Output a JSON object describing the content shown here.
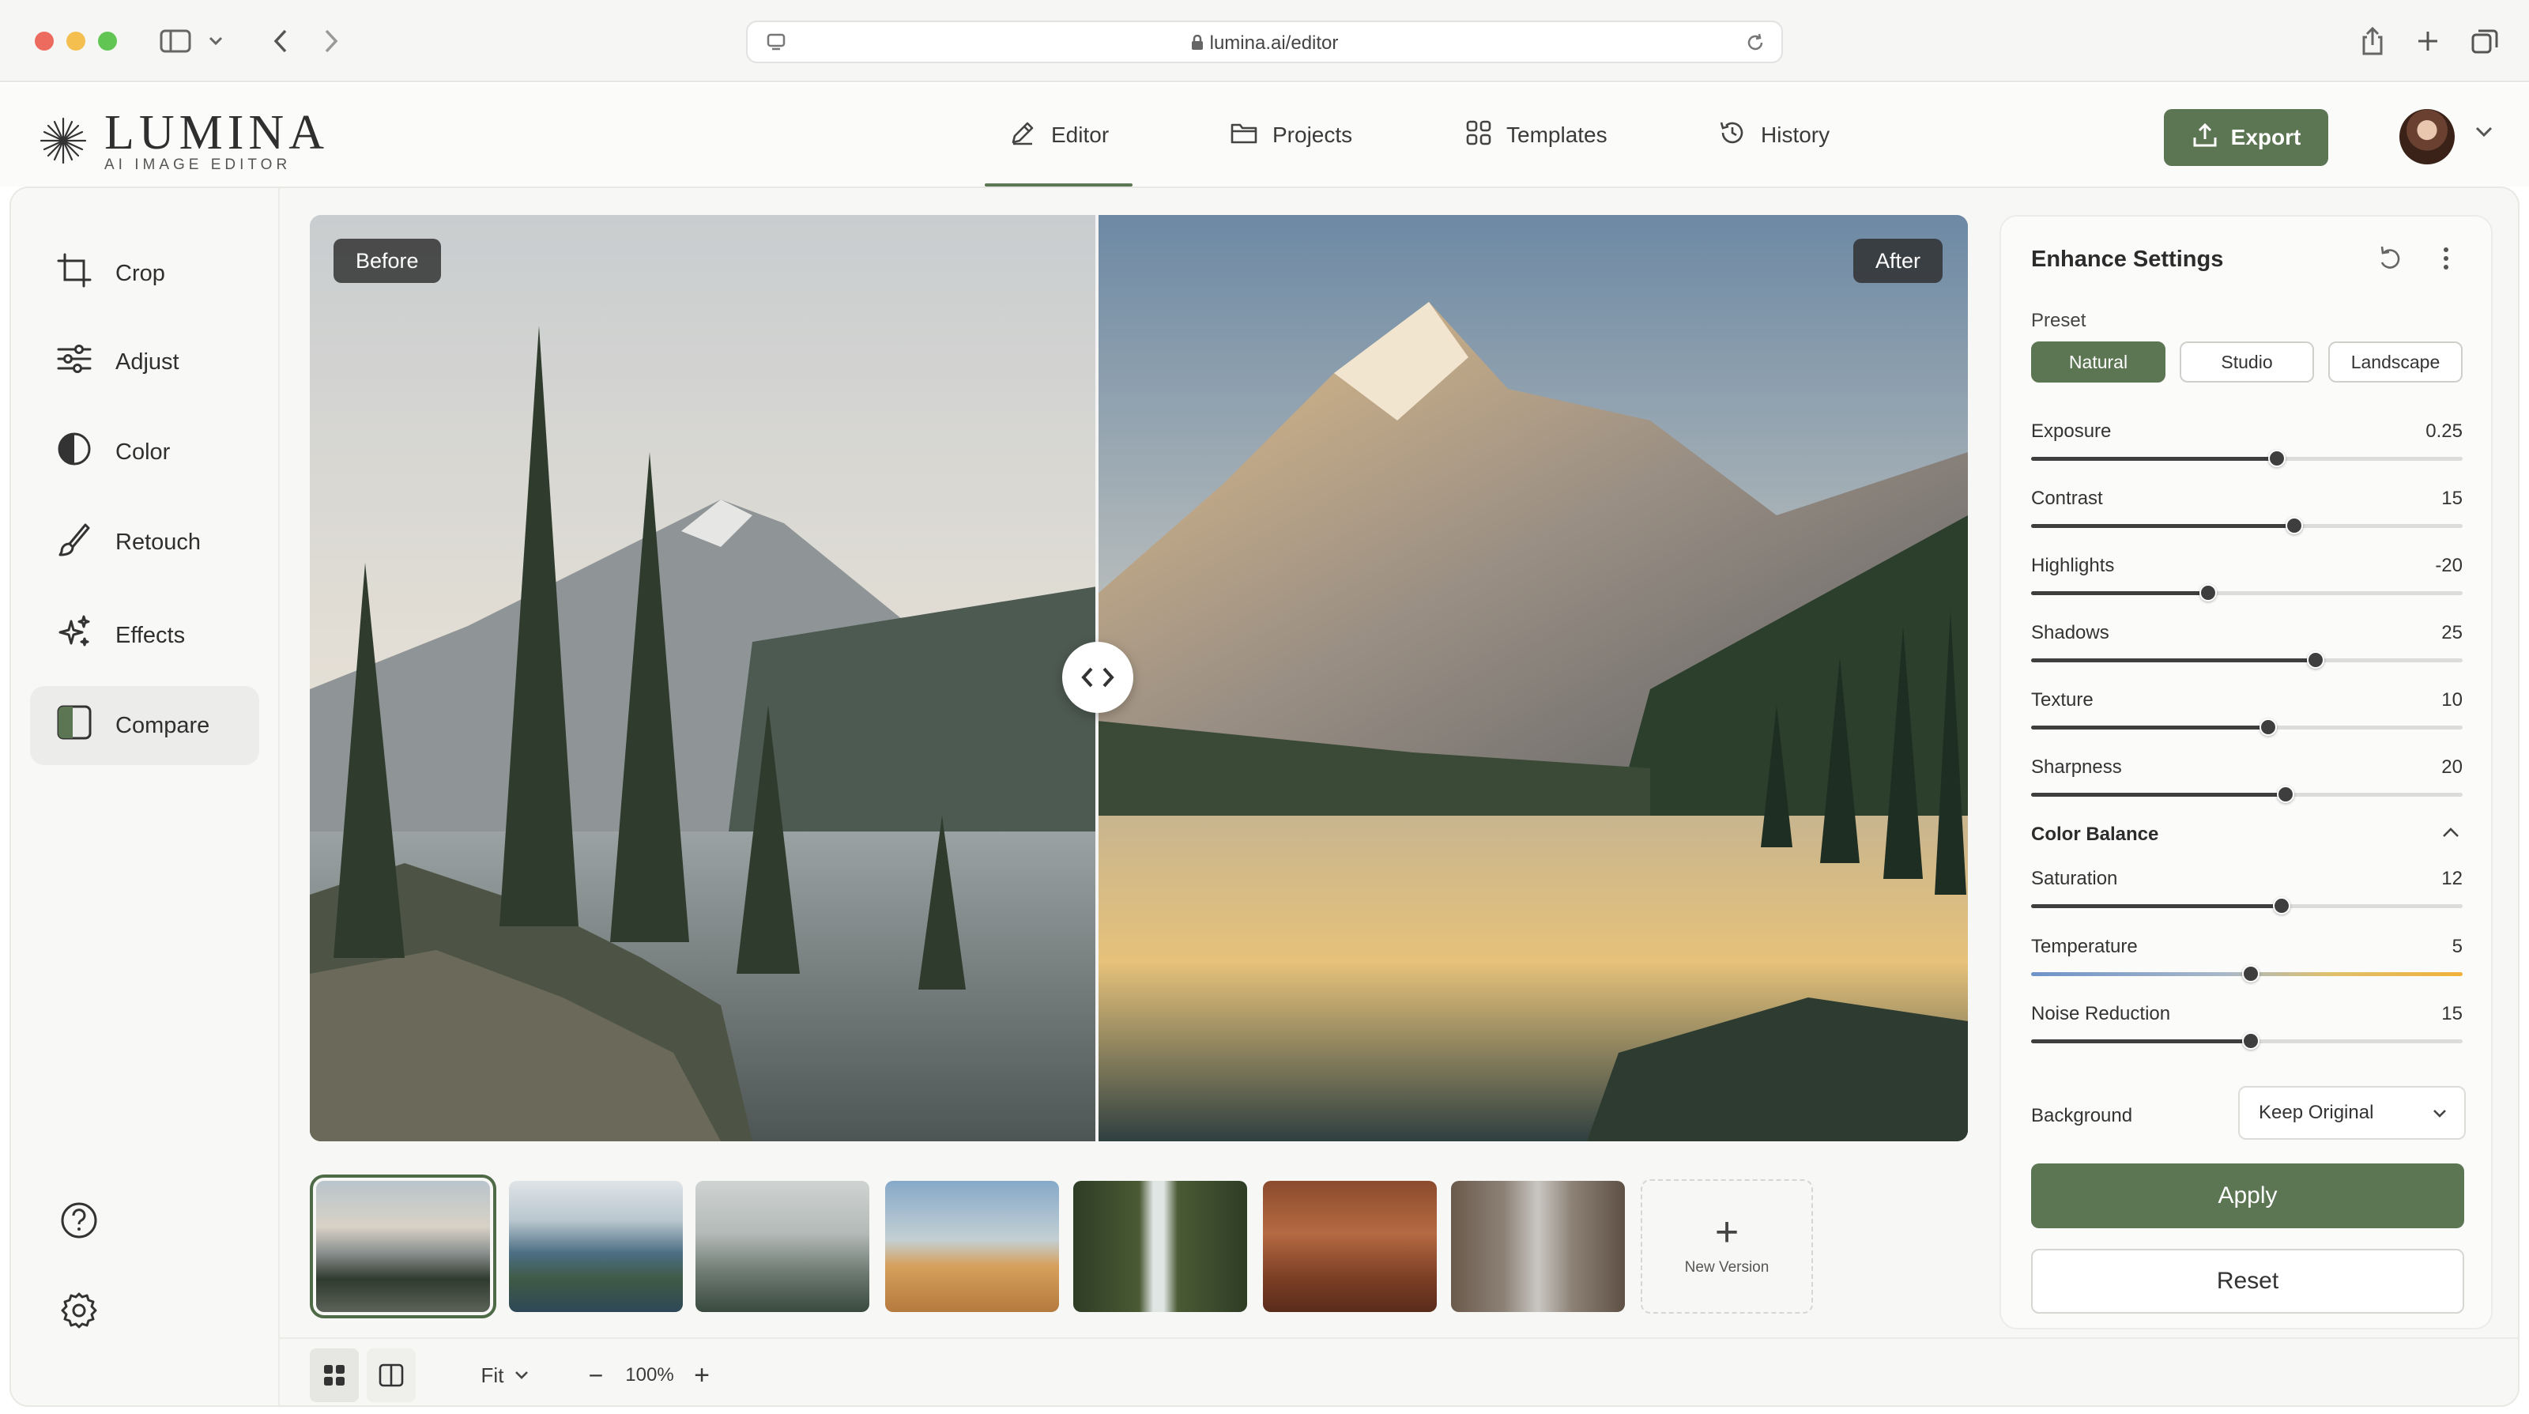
{
  "browser": {
    "url": "lumina.ai/editor"
  },
  "app": {
    "brand": "LUMINA",
    "tagline": "AI IMAGE EDITOR",
    "accent": "#5c7553"
  },
  "nav": {
    "tabs": [
      {
        "label": "Editor",
        "icon": "edit-icon",
        "active": true
      },
      {
        "label": "Projects",
        "icon": "folder-icon",
        "active": false
      },
      {
        "label": "Templates",
        "icon": "grid-icon",
        "active": false
      },
      {
        "label": "History",
        "icon": "history-icon",
        "active": false
      }
    ],
    "export_label": "Export"
  },
  "sidebar": {
    "tools": [
      {
        "label": "Crop",
        "icon": "crop-icon",
        "active": false
      },
      {
        "label": "Adjust",
        "icon": "sliders-icon",
        "active": false
      },
      {
        "label": "Color",
        "icon": "contrast-icon",
        "active": false
      },
      {
        "label": "Retouch",
        "icon": "brush-icon",
        "active": false
      },
      {
        "label": "Effects",
        "icon": "sparkles-icon",
        "active": false
      },
      {
        "label": "Compare",
        "icon": "compare-icon",
        "active": true
      }
    ],
    "bottom_icons": [
      "help-icon",
      "settings-icon"
    ]
  },
  "canvas": {
    "before_label": "Before",
    "after_label": "After"
  },
  "thumbnails": {
    "items": [
      "mountain-lake",
      "coastal-island",
      "misty-forest",
      "desert-tree",
      "waterfall",
      "canyon-city",
      "city-street"
    ],
    "selected_index": 0,
    "new_version_label": "New Version"
  },
  "toolbar": {
    "fit_label": "Fit",
    "zoom_label": "100%",
    "zoom_out": "−",
    "zoom_in": "+"
  },
  "panel": {
    "title": "Enhance Settings",
    "preset_label": "Preset",
    "presets": [
      {
        "label": "Natural",
        "active": true
      },
      {
        "label": "Studio",
        "active": false
      },
      {
        "label": "Landscape",
        "active": false
      }
    ],
    "sliders": [
      {
        "name": "Exposure",
        "value": "0.25",
        "fraction": 0.57
      },
      {
        "name": "Contrast",
        "value": "15",
        "fraction": 0.61
      },
      {
        "name": "Highlights",
        "value": "-20",
        "fraction": 0.41
      },
      {
        "name": "Shadows",
        "value": "25",
        "fraction": 0.66
      },
      {
        "name": "Texture",
        "value": "10",
        "fraction": 0.55
      },
      {
        "name": "Sharpness",
        "value": "20",
        "fraction": 0.59
      }
    ],
    "color_balance_title": "Color Balance",
    "color_sliders": [
      {
        "name": "Saturation",
        "value": "12",
        "fraction": 0.58
      },
      {
        "name": "Temperature",
        "value": "5",
        "fraction": 0.51
      },
      {
        "name": "Noise Reduction",
        "value": "15",
        "fraction": 0.51
      }
    ],
    "background_label": "Background",
    "background_value": "Keep Original",
    "apply_label": "Apply",
    "reset_label": "Reset"
  }
}
